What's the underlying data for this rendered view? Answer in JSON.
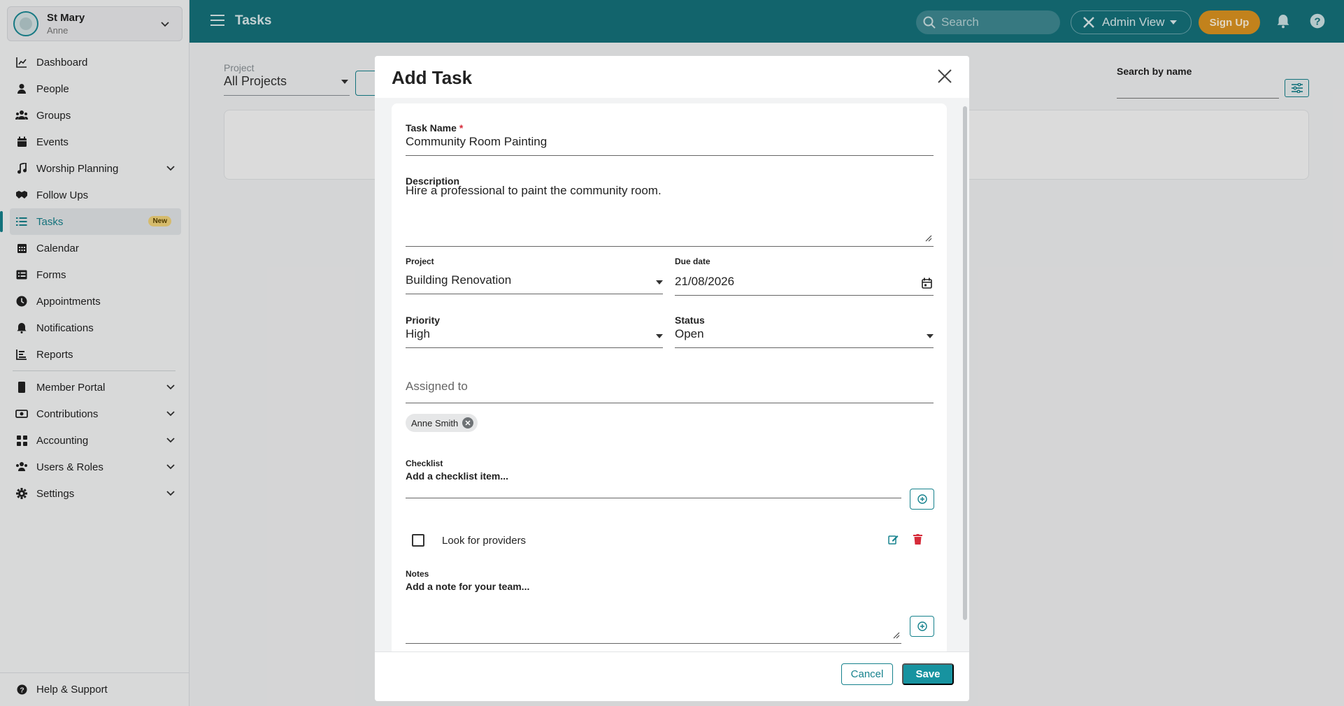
{
  "org": {
    "name": "St Mary",
    "user": "Anne"
  },
  "sidebar": {
    "items": [
      {
        "label": "Dashboard",
        "icon": "chart-line-icon"
      },
      {
        "label": "People",
        "icon": "person-icon"
      },
      {
        "label": "Groups",
        "icon": "users-icon"
      },
      {
        "label": "Events",
        "icon": "calendar-icon"
      },
      {
        "label": "Worship Planning",
        "icon": "music-icon"
      },
      {
        "label": "Follow Ups",
        "icon": "handshake-icon"
      },
      {
        "label": "Tasks",
        "icon": "list-icon",
        "badge": "New"
      },
      {
        "label": "Calendar",
        "icon": "calendar-grid-icon"
      },
      {
        "label": "Forms",
        "icon": "form-icon"
      },
      {
        "label": "Appointments",
        "icon": "clock-icon"
      },
      {
        "label": "Notifications",
        "icon": "bell-icon"
      },
      {
        "label": "Reports",
        "icon": "bar-chart-icon"
      },
      {
        "label": "Member Portal",
        "icon": "mobile-icon"
      },
      {
        "label": "Contributions",
        "icon": "money-icon"
      },
      {
        "label": "Accounting",
        "icon": "grid-icon"
      },
      {
        "label": "Users & Roles",
        "icon": "users-roles-icon"
      },
      {
        "label": "Settings",
        "icon": "gear-icon"
      }
    ],
    "help": "Help & Support"
  },
  "topbar": {
    "title": "Tasks",
    "search_placeholder": "Search",
    "admin_view": "Admin View",
    "signup": "Sign Up"
  },
  "page": {
    "project_label": "Project",
    "project_value": "All Projects",
    "search_by_name": "Search by name"
  },
  "modal": {
    "title": "Add Task",
    "task_name_label": "Task Name",
    "required_mark": "*",
    "task_name_value": "Community Room Painting",
    "description_label": "Description",
    "description_value": "Hire a professional to paint the community room.",
    "project_label": "Project",
    "project_value": "Building Renovation",
    "due_date_label": "Due date",
    "due_date_value": "21/08/2026",
    "priority_label": "Priority",
    "priority_value": "High",
    "status_label": "Status",
    "status_value": "Open",
    "assigned_placeholder": "Assigned to",
    "assignee_chip": "Anne Smith",
    "checklist_label": "Checklist",
    "checklist_placeholder": "Add a checklist item...",
    "checklist_items": [
      {
        "label": "Look for providers",
        "checked": false
      }
    ],
    "notes_label": "Notes",
    "notes_placeholder": "Add a note for your team...",
    "cancel": "Cancel",
    "save": "Save"
  },
  "colors": {
    "brand": "#15727c",
    "accent": "#1793a0",
    "signup": "#dd9520",
    "danger": "#d62b3a"
  }
}
